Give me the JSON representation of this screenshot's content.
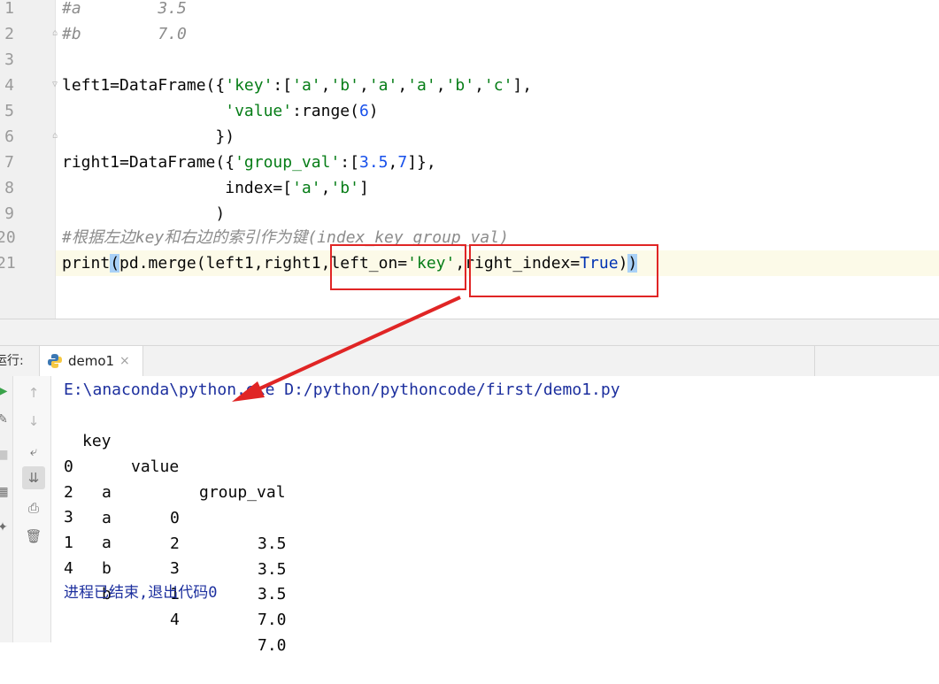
{
  "editor": {
    "line_numbers": [
      "1",
      "2",
      "3",
      "4",
      "5",
      "6",
      "7",
      "8",
      "9",
      "20",
      "21"
    ],
    "lines": [
      "#a        3.5",
      "#b        7.0",
      "",
      "left1=DataFrame({'key':['a','b','a','a','b','c'],",
      "                 'value':range(6)",
      "                })",
      "right1=DataFrame({'group_val':[3.5,7]},",
      "                 index=['a','b']",
      "                )",
      "#根据左边key和右边的索引作为键(index_key group_val)",
      "print(pd.merge(left1,right1,left_on='key',right_index=True))"
    ]
  },
  "run_panel": {
    "label": "运行:",
    "tab_label": "demo1",
    "close_glyph": "×",
    "command": "E:\\anaconda\\python.exe D:/python/pythoncode/first/demo1.py",
    "columns": [
      "key",
      "value",
      "group_val"
    ],
    "rows": [
      {
        "index": "0",
        "key": "a",
        "value": "0",
        "group_val": "3.5"
      },
      {
        "index": "2",
        "key": "a",
        "value": "2",
        "group_val": "3.5"
      },
      {
        "index": "3",
        "key": "a",
        "value": "3",
        "group_val": "3.5"
      },
      {
        "index": "1",
        "key": "b",
        "value": "1",
        "group_val": "7.0"
      },
      {
        "index": "4",
        "key": "b",
        "value": "4",
        "group_val": "7.0"
      }
    ],
    "exit_message": "进程已结束,退出代码0"
  },
  "colors": {
    "annotation": "#e02525",
    "string": "#067d17",
    "number": "#1750eb",
    "keyword": "#0033b3",
    "comment": "#8c8c8c"
  },
  "icons": [
    "run-icon",
    "wrench-icon",
    "stop-icon",
    "layout-icon",
    "pin-icon",
    "up-arrow-icon",
    "down-arrow-icon",
    "soft-wrap-icon",
    "scroll-to-end-icon",
    "print-icon",
    "trash-icon",
    "python-icon",
    "close-icon",
    "fold-icon"
  ]
}
